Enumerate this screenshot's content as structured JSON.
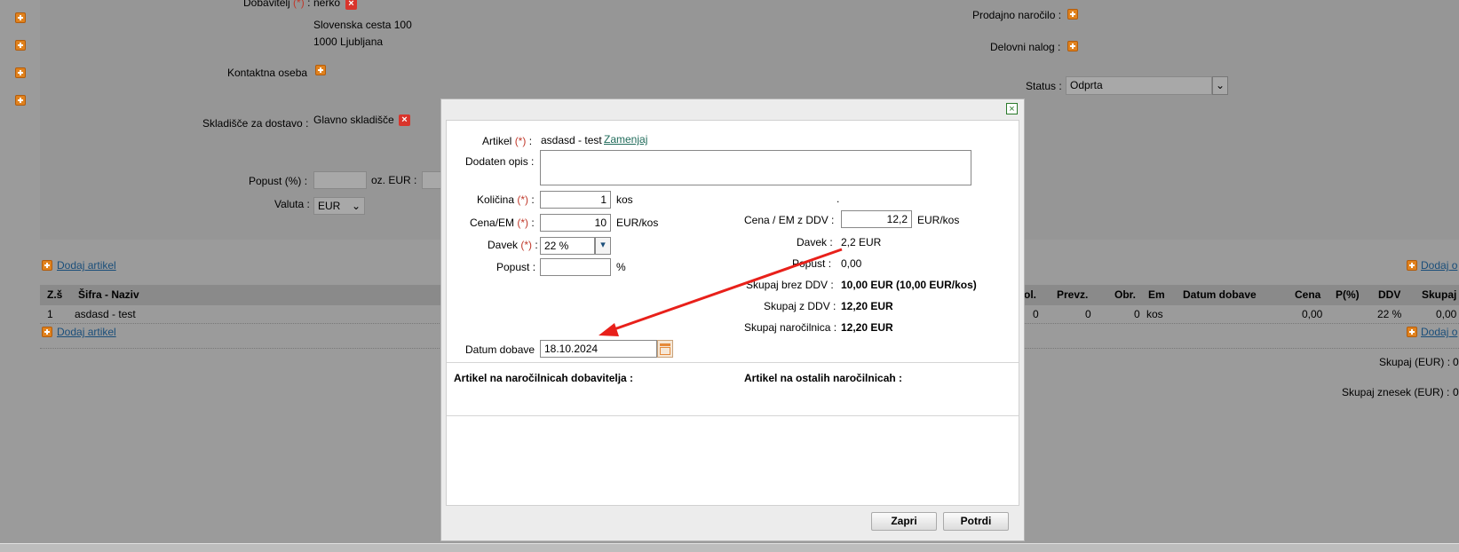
{
  "bg": {
    "supplier_label": "Dobavitelj",
    "supplier_req": "(*)",
    "supplier_colon": ":",
    "supplier_name": "nerko",
    "address1": "Slovenska cesta 100",
    "address2": "1000 Ljubljana",
    "contact_label": "Kontaktna oseba",
    "warehouse_label": "Skladišče za dostavo :",
    "warehouse_value": "Glavno skladišče",
    "discount_label": "Popust (%) :",
    "discount_eur_label": "oz. EUR :",
    "currency_label": "Valuta :",
    "currency_value": "EUR",
    "sales_order_label": "Prodajno naročilo :",
    "work_order_label": "Delovni nalog :",
    "status_label": "Status :",
    "status_value": "Odprta",
    "add_article_link": "Dodaj artikel",
    "add_article_link_right": "Dodaj o",
    "table": {
      "headers": [
        "Z.š",
        "Šifra - Naziv",
        "ol.",
        "Prevz.",
        "Obr.",
        "Em",
        "Datum dobave",
        "Cena",
        "P(%)",
        "DDV",
        "Skupaj"
      ],
      "row": [
        "1",
        "asdasd - test",
        "0",
        "0",
        "0",
        "kos",
        "",
        "0,00",
        "",
        "22 %",
        "0,00"
      ]
    },
    "total_eur_label": "Skupaj (EUR) :",
    "total_eur_value": "0",
    "total_amount_label": "Skupaj znesek (EUR) :",
    "total_amount_value": "0"
  },
  "modal": {
    "article_label": "Artikel",
    "req": "(*)",
    "colon": ":",
    "article_value": "asdasd - test",
    "replace_link": "Zamenjaj",
    "extra_desc_label": "Dodaten opis :",
    "extra_desc_value": "",
    "qty_label": "Količina",
    "qty_value": "1",
    "qty_unit": "kos",
    "price_label": "Cena/EM",
    "price_value": "10",
    "price_unit": "EUR/kos",
    "tax_label": "Davek",
    "tax_value": "22 %",
    "discount_label": "Popust :",
    "discount_value": "",
    "discount_unit": "%",
    "dot": ".",
    "price_vat_label": "Cena / EM z DDV :",
    "price_vat_value": "12,2",
    "price_vat_unit": "EUR/kos",
    "tax_amount_label": "Davek :",
    "tax_amount_value": "2,2 EUR",
    "discount_amount_label": "Popust :",
    "discount_amount_value": "0,00",
    "total_no_vat_label": "Skupaj brez DDV :",
    "total_no_vat_value": "10,00 EUR (10,00 EUR/kos)",
    "total_vat_label": "Skupaj z DDV :",
    "total_vat_value": "12,20 EUR",
    "total_order_label": "Skupaj naročilnica :",
    "total_order_value": "12,20 EUR",
    "delivery_date_label": "Datum dobave",
    "delivery_date_value": "18.10.2024",
    "supplier_orders_heading": "Artikel na naročilnicah dobavitelja :",
    "other_orders_heading": "Artikel na ostalih naročilnicah :",
    "close_button": "Zapri",
    "confirm_button": "Potrdi",
    "close_x": "×"
  },
  "colors": {
    "overlay": "#9b9b9b",
    "required": "#c0392b",
    "arrow": "#e8201a",
    "link": "#1a4e7a",
    "plus_icon": "#e0821e"
  }
}
